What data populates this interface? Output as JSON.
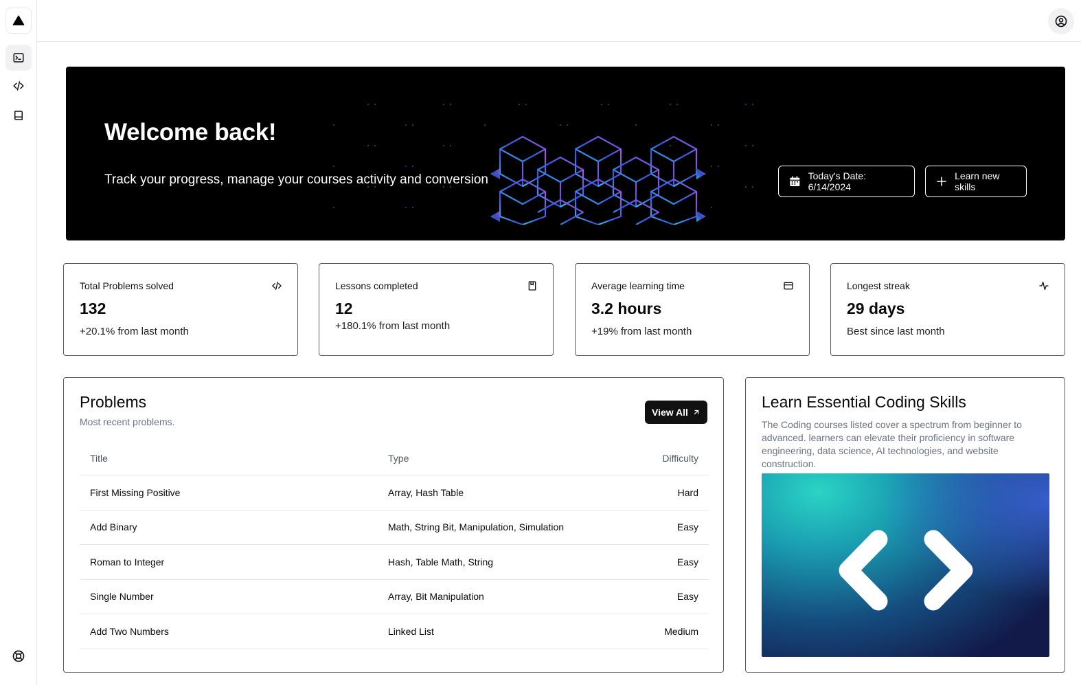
{
  "hero": {
    "title": "Welcome back!",
    "subtitle": "Track your progress, manage your courses activity and conversion",
    "date_button": "Today's Date: 6/14/2024",
    "learn_button": "Learn new skills"
  },
  "stats": [
    {
      "label": "Total Problems solved",
      "value": "132",
      "sub": "+20.1% from last month",
      "icon": "code-icon"
    },
    {
      "label": "Lessons completed",
      "value": "12",
      "sub": "+180.1% from last month",
      "icon": "book-icon"
    },
    {
      "label": "Average learning time",
      "value": "3.2 hours",
      "sub": "+19% from last month",
      "icon": "credit-card-icon"
    },
    {
      "label": "Longest streak",
      "value": "29 days",
      "sub": "Best since last month",
      "icon": "activity-icon"
    }
  ],
  "problems": {
    "title": "Problems",
    "subtitle": "Most recent problems.",
    "view_all": "View All",
    "columns": [
      "Title",
      "Type",
      "Difficulty"
    ],
    "rows": [
      {
        "title": "First Missing Positive",
        "type": "Array, Hash Table",
        "difficulty": "Hard"
      },
      {
        "title": "Add Binary",
        "type": "Math, String Bit, Manipulation, Simulation",
        "difficulty": "Easy"
      },
      {
        "title": "Roman to Integer",
        "type": "Hash, Table Math, String",
        "difficulty": "Easy"
      },
      {
        "title": "Single Number",
        "type": "Array, Bit Manipulation",
        "difficulty": "Easy"
      },
      {
        "title": "Add Two Numbers",
        "type": "Linked List",
        "difficulty": "Medium"
      }
    ]
  },
  "learn": {
    "title": "Learn Essential Coding Skills",
    "description": "The Coding courses listed cover a spectrum from beginner to advanced. learners can elevate their proficiency in software engineering, data science, AI technologies, and website construction."
  },
  "sidebar": {
    "icons": [
      "terminal-icon",
      "code-icon",
      "book-icon"
    ],
    "help_icon": "lifebuoy-icon",
    "logo_icon": "triangle-logo-icon"
  },
  "colors": {
    "hero_bg": "#000000",
    "accent_cyan": "#25cfc0",
    "accent_purple": "#9b59d6",
    "primary_button": "#111111"
  }
}
